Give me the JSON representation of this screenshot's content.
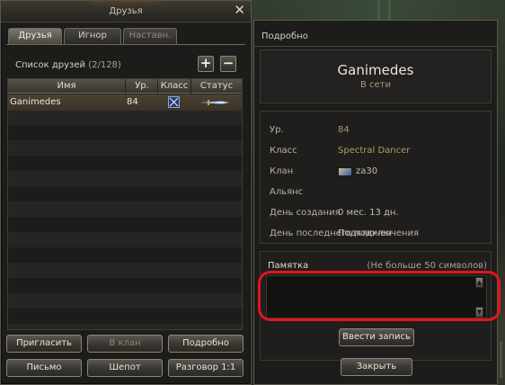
{
  "friends_window": {
    "title": "Друзья",
    "close_glyph": "✕",
    "tabs": [
      {
        "label": "Друзья",
        "active": true
      },
      {
        "label": "Игнор",
        "active": false
      },
      {
        "label": "Наставн.",
        "active": false
      }
    ],
    "list_title": "Список друзей",
    "list_count": "(2/128)",
    "add_glyph": "+",
    "remove_glyph": "−",
    "table": {
      "columns": [
        "Имя",
        "Ур.",
        "Класс",
        "Статус"
      ],
      "rows": [
        {
          "name": "Ganimedes",
          "level": "84",
          "class_icon": "class-icon",
          "status_icon": "sword-icon"
        }
      ]
    },
    "buttons": {
      "invite": "Пригласить",
      "to_clan": "В клан",
      "details": "Подробно",
      "letter": "Письмо",
      "whisper": "Шепот",
      "chat": "Разговор 1:1"
    }
  },
  "details_window": {
    "title": "Подробно",
    "name": "Ganimedes",
    "status": "В сети",
    "fields": {
      "level_label": "Ур.",
      "level_value": "84",
      "class_label": "Класс",
      "class_value": "Spectral Dancer",
      "clan_label": "Клан",
      "clan_value": "za30",
      "alliance_label": "Альянс",
      "created_label": "День создания",
      "created_value": "0 мес. 13 дн.",
      "last_login_label": "День последнего подключения",
      "last_login_value": "Подключен"
    },
    "memo": {
      "label": "Памятка",
      "limit": "(Не больше 50 символов)",
      "value": ""
    },
    "buttons": {
      "save_note": "Ввести запись",
      "close": "Закрыть"
    }
  },
  "colors": {
    "highlight": "#e0161a",
    "status_online": "#a79a73",
    "value_text": "#b09a6a"
  }
}
